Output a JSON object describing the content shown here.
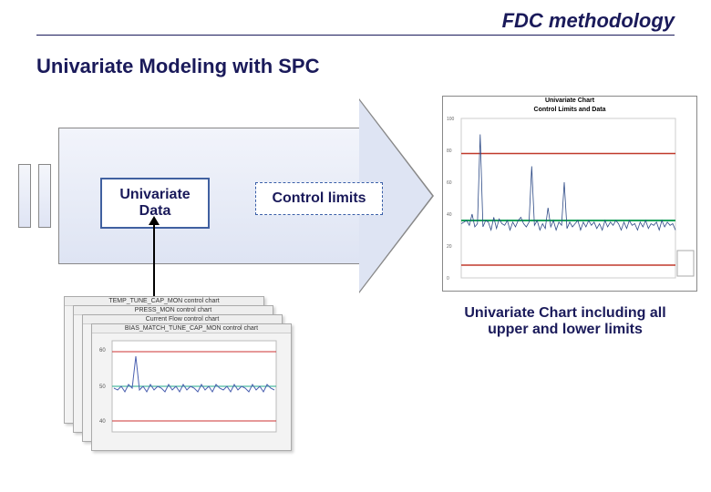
{
  "header": "FDC methodology",
  "section_title": "Univariate Modeling with SPC",
  "boxes": {
    "data": "Univariate Data",
    "control": "Control limits"
  },
  "mini_titles": [
    "TEMP_TUNE_CAP_MON control chart",
    "PRESS_MON control chart",
    "Current Flow control chart",
    "BIAS_MATCH_TUNE_CAP_MON control chart"
  ],
  "big_chart": {
    "title_line1": "Univariate Chart",
    "title_line2": "Control Limits and Data"
  },
  "caption": "Univariate Chart including all upper and lower limits",
  "chart_data": {
    "type": "line",
    "title": "Univariate Chart — Control Limits and Data",
    "xlabel": "",
    "ylabel": "",
    "ylim": [
      0,
      100
    ],
    "control_lines": {
      "upper_red": 78,
      "center_green": 36,
      "lower_red": 8
    },
    "series": [
      {
        "name": "value",
        "values": [
          34,
          35,
          36,
          33,
          40,
          32,
          34,
          90,
          32,
          36,
          35,
          30,
          38,
          31,
          37,
          34,
          33,
          36,
          30,
          35,
          32,
          36,
          38,
          34,
          32,
          35,
          70,
          33,
          36,
          30,
          34,
          31,
          44,
          32,
          36,
          30,
          35,
          33,
          60,
          31,
          35,
          32,
          34,
          36,
          30,
          35,
          32,
          36,
          33,
          35,
          31,
          34,
          30,
          36,
          32,
          35,
          33,
          36,
          34,
          30,
          35,
          31,
          36,
          33,
          34,
          30,
          35,
          32,
          36,
          31,
          34,
          33,
          35,
          30,
          36,
          32,
          35,
          33,
          34,
          30
        ]
      }
    ]
  }
}
